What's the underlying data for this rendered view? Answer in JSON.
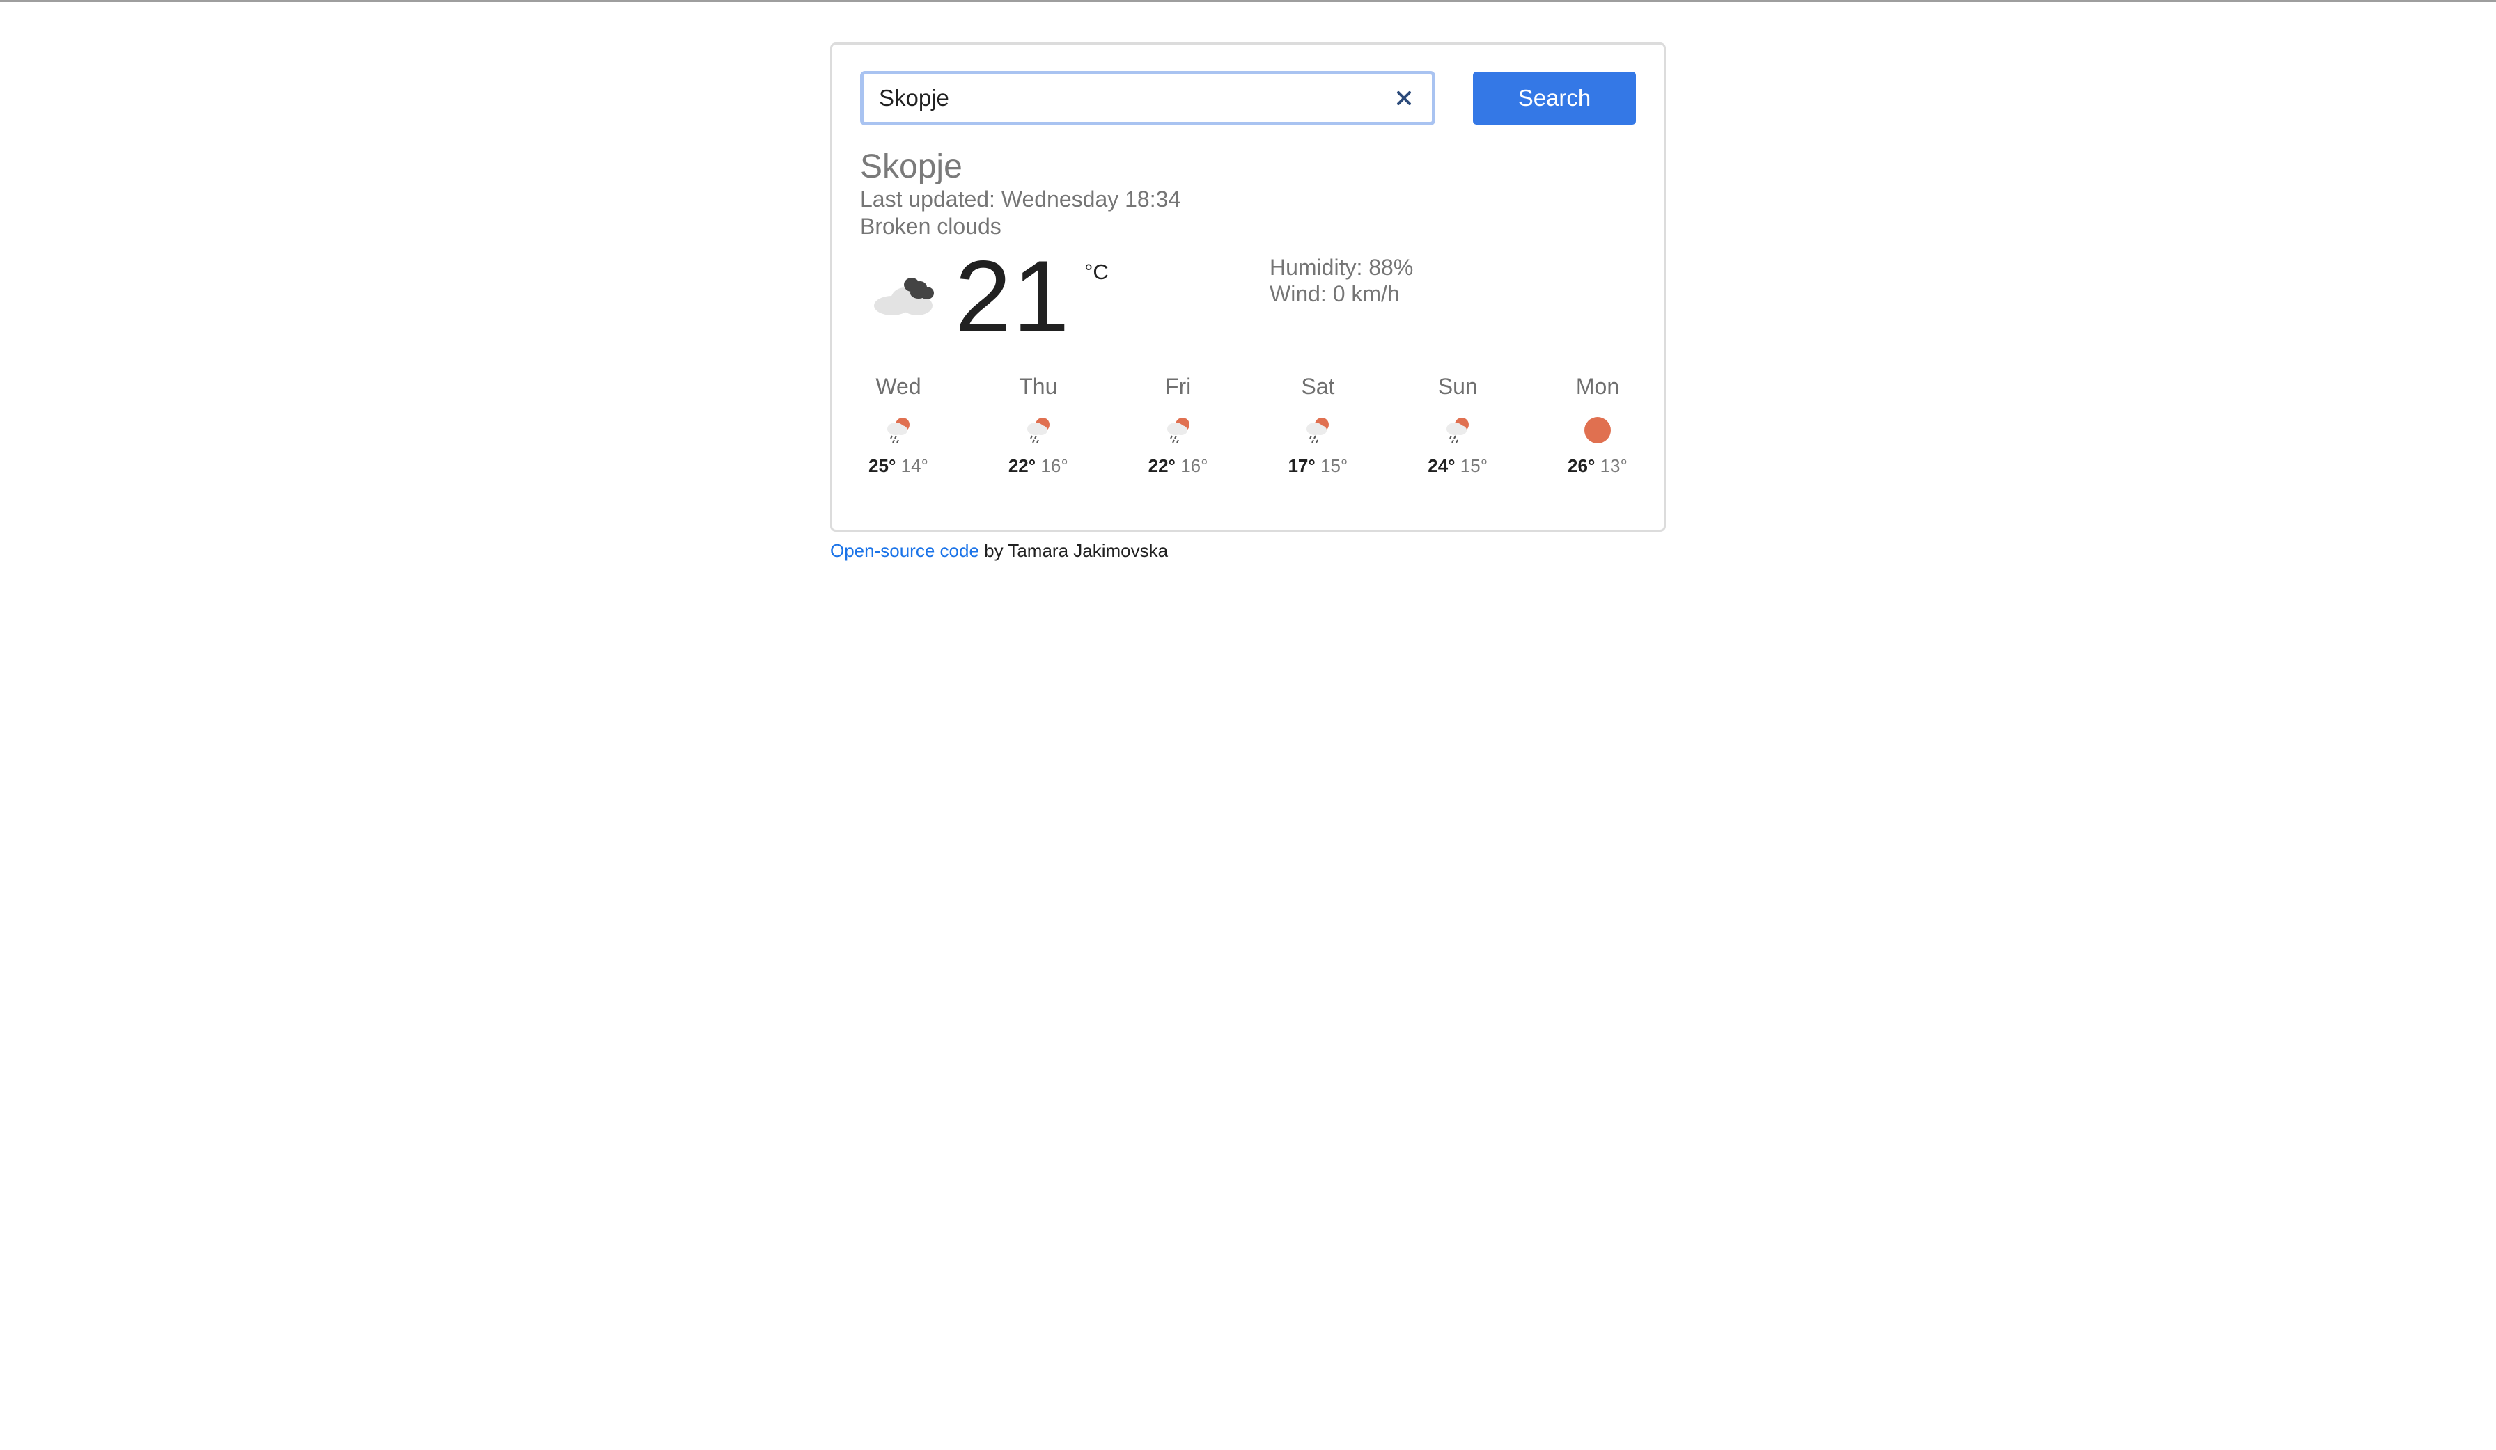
{
  "search": {
    "value": "Skopje",
    "button_label": "Search",
    "clear_icon": "close-icon"
  },
  "current": {
    "city": "Skopje",
    "last_updated": "Last updated: Wednesday 18:34",
    "description": "Broken clouds",
    "temperature": "21",
    "unit": "°C",
    "humidity": "Humidity: 88%",
    "wind": "Wind: 0 km/h",
    "icon": "broken-clouds-icon"
  },
  "forecast": [
    {
      "day": "Wed",
      "high": "25°",
      "low": "14°",
      "icon": "rain-sun-icon"
    },
    {
      "day": "Thu",
      "high": "22°",
      "low": "16°",
      "icon": "rain-sun-icon"
    },
    {
      "day": "Fri",
      "high": "22°",
      "low": "16°",
      "icon": "rain-sun-icon"
    },
    {
      "day": "Sat",
      "high": "17°",
      "low": "15°",
      "icon": "rain-sun-icon"
    },
    {
      "day": "Sun",
      "high": "24°",
      "low": "15°",
      "icon": "rain-sun-icon"
    },
    {
      "day": "Mon",
      "high": "26°",
      "low": "13°",
      "icon": "sun-icon"
    }
  ],
  "footer": {
    "link_text": "Open-source code",
    "suffix": " by Tamara Jakimovska"
  },
  "colors": {
    "accent": "#3478e6",
    "link": "#1a73e8",
    "sun": "#e07050",
    "input_border": "#a9c3f1"
  }
}
